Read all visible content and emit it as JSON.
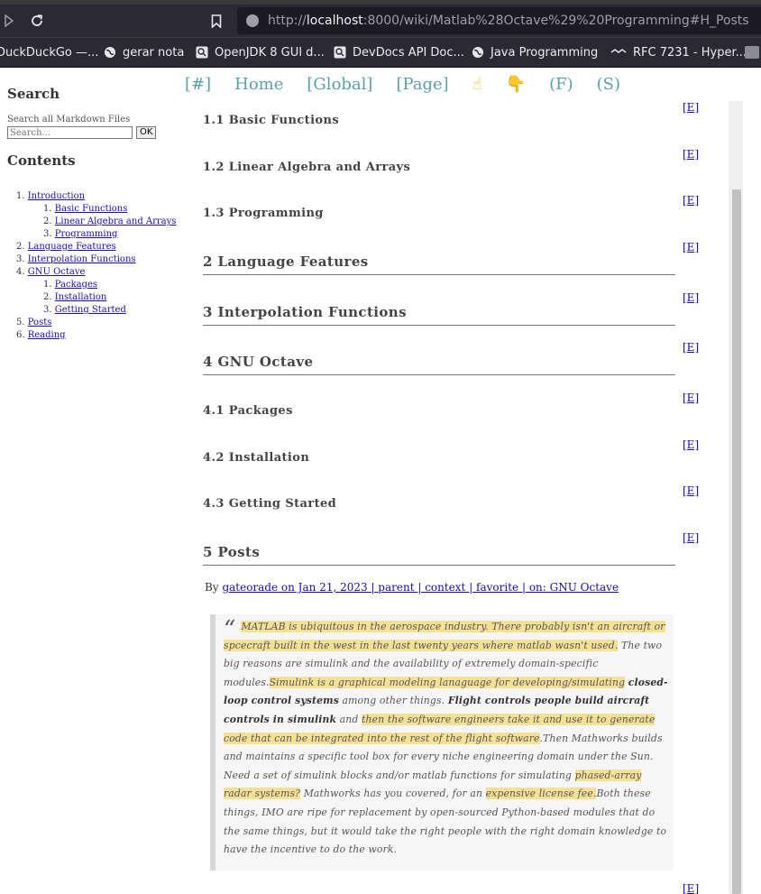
{
  "browser": {
    "url_host": "localhost",
    "url_rest": ":8000/wiki/Matlab%28Octave%29%20Programming#H_Posts",
    "url_prefix": "http://"
  },
  "bookmarks": [
    {
      "label": "DuckDuckGo —...",
      "icon": "duckduckgo-icon"
    },
    {
      "label": "gerar nota",
      "icon": "globe-icon"
    },
    {
      "label": "OpenJDK 8 GUI d...",
      "icon": "search-page-icon"
    },
    {
      "label": "DevDocs API Doc...",
      "icon": "search-page-icon"
    },
    {
      "label": "Java Programming",
      "icon": "globe-icon"
    },
    {
      "label": "RFC 7231 - Hyper...",
      "icon": "rfc-icon"
    }
  ],
  "topmenu": [
    "[#]",
    "Home",
    "[Global]",
    "[Page]",
    "☝",
    "👇",
    "(F)",
    "(S)"
  ],
  "sidebar": {
    "search_title": "Search",
    "search_label": "Search all Markdown Files",
    "search_placeholder": "Search...",
    "ok_label": "OK",
    "contents_title": "Contents",
    "toc": [
      {
        "num": "1.",
        "label": "Introduction",
        "children": [
          {
            "num": "1.",
            "label": "Basic Functions"
          },
          {
            "num": "2.",
            "label": "Linear Algebra and Arrays"
          },
          {
            "num": "3.",
            "label": "Programming"
          }
        ]
      },
      {
        "num": "2.",
        "label": "Language Features",
        "children": []
      },
      {
        "num": "3.",
        "label": "Interpolation Functions",
        "children": []
      },
      {
        "num": "4.",
        "label": "GNU Octave",
        "children": [
          {
            "num": "1.",
            "label": "Packages"
          },
          {
            "num": "2.",
            "label": "Installation"
          },
          {
            "num": "3.",
            "label": "Getting Started"
          }
        ]
      },
      {
        "num": "5.",
        "label": "Posts",
        "children": []
      },
      {
        "num": "6.",
        "label": "Reading",
        "children": []
      }
    ]
  },
  "sections": [
    {
      "title": "1.1 Basic Functions",
      "level": 3
    },
    {
      "title": "1.2 Linear Algebra and Arrays",
      "level": 3
    },
    {
      "title": "1.3 Programming",
      "level": 3
    },
    {
      "title": "2 Language Features",
      "level": 2
    },
    {
      "title": "3 Interpolation Functions",
      "level": 2
    },
    {
      "title": "4 GNU Octave",
      "level": 2
    },
    {
      "title": "4.1 Packages",
      "level": 3
    },
    {
      "title": "4.2 Installation",
      "level": 3
    },
    {
      "title": "4.3 Getting Started",
      "level": 3
    },
    {
      "title": "5 Posts",
      "level": 2
    }
  ],
  "edit_label": "[E]",
  "post": {
    "by": "By",
    "meta_link": "gateorade on Jan 21, 2023 | parent | context | favorite | on: GNU Octave"
  },
  "quote_segments": [
    {
      "t": "MATLAB is ubiquitous in the aerospace industry. There probably isn't an aircraft or spcecraft built in the west in the last twenty years where matlab wasn't used.",
      "s": "hl"
    },
    {
      "t": " The two big reasons are simulink and the availability of extremely domain-specific modules.",
      "s": ""
    },
    {
      "t": "Simulink is a graphical modeling lanaguage for developing/simulating",
      "s": "hl"
    },
    {
      "t": " ",
      "s": ""
    },
    {
      "t": "closed-loop control systems",
      "s": "b"
    },
    {
      "t": " among other things. ",
      "s": ""
    },
    {
      "t": "Flight controls people build aircraft controls in simulink",
      "s": "b"
    },
    {
      "t": " and ",
      "s": ""
    },
    {
      "t": "then the software engineers take it and use it to generate code that can be integrated into the rest of the flight software",
      "s": "hl"
    },
    {
      "t": ".Then Mathworks builds and maintains a specific tool box for every niche engineering domain under the Sun. Need a set of simulink blocks and/or matlab functions for simulating ",
      "s": ""
    },
    {
      "t": "phased-array radar systems?",
      "s": "hl"
    },
    {
      "t": " Mathworks has you covered, for an ",
      "s": ""
    },
    {
      "t": "expensive license fee.",
      "s": "hl"
    },
    {
      "t": "Both these things, IMO are ripe for replacement by open-sourced Python-based modules that do the same things, but it would take the right people with the right domain knowledge to have the incentive to do the work.",
      "s": ""
    }
  ]
}
